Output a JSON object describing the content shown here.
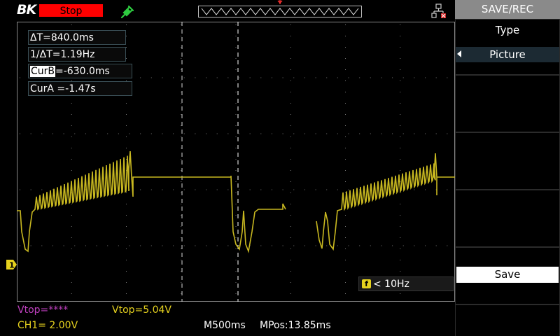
{
  "header": {
    "brand": "BK",
    "run_state": "Stop",
    "run_state_color": "#ff0000"
  },
  "measurements": {
    "delta_t": "ΔT=840.0ms",
    "inv_delta_t": "1/ΔT=1.19Hz",
    "cursor_b_label": "CurB",
    "cursor_b_value": "=-630.0ms",
    "cursor_a": "CurA =-1.47s"
  },
  "channel": {
    "marker": "1",
    "color": "#e6d21e"
  },
  "frequency": {
    "icon_letter": "f",
    "text": "< 10Hz"
  },
  "status": {
    "vtop_a": "Vtop=****",
    "vtop_b": "Vtop=5.04V",
    "ch1_scale": "CH1= 2.00V",
    "timebase": "M500ms",
    "mpos": "MPos:13.85ms"
  },
  "menu": {
    "title": "SAVE/REC",
    "type_label": "Type",
    "type_value": "Picture",
    "save_label": "Save"
  },
  "icons": {
    "trigger": "trigger-plug-icon",
    "usb": "usb-network-icon",
    "channel_marker": "channel-ground-marker-icon"
  }
}
